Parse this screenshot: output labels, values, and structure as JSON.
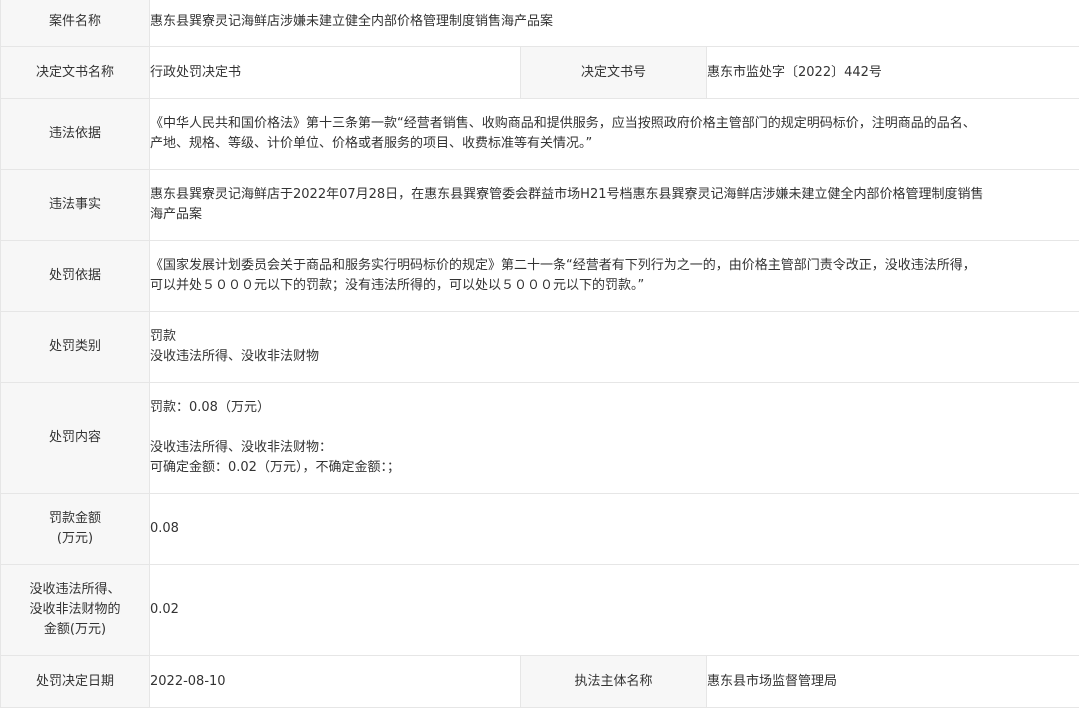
{
  "rows": {
    "case_name": {
      "label": "案件名称",
      "value": "惠东县巽寮灵记海鲜店涉嫌未建立健全内部价格管理制度销售海产品案"
    },
    "decision_doc": {
      "label": "决定文书名称",
      "value": "行政处罚决定书",
      "label2": "决定文书号",
      "value2": "惠东市监处字〔2022〕442号"
    },
    "violation_basis": {
      "label": "违法依据",
      "lines": [
        "《中华人民共和国价格法》第十三条第一款“经营者销售、收购商品和提供服务，应当按照政府价格主管部门的规定明码标价，注明商品的品名、",
        "产地、规格、等级、计价单位、价格或者服务的项目、收费标准等有关情况。”"
      ]
    },
    "violation_facts": {
      "label": "违法事实",
      "lines": [
        "惠东县巽寮灵记海鲜店于2022年07月28日，在惠东县巽寮管委会群益市场H21号档惠东县巽寮灵记海鲜店涉嫌未建立健全内部价格管理制度销售",
        "海产品案"
      ]
    },
    "penalty_basis": {
      "label": "处罚依据",
      "lines": [
        "《国家发展计划委员会关于商品和服务实行明码标价的规定》第二十一条“经营者有下列行为之一的，由价格主管部门责令改正，没收违法所得，",
        "可以并处５０００元以下的罚款；没有违法所得的，可以处以５０００元以下的罚款。”"
      ]
    },
    "penalty_type": {
      "label": "处罚类别",
      "lines": [
        "罚款",
        "没收违法所得、没收非法财物"
      ]
    },
    "penalty_content": {
      "label": "处罚内容",
      "line1": "罚款：0.08（万元）",
      "line2": "没收违法所得、没收非法财物：",
      "line3": "可确定金额：0.02（万元），不确定金额：；"
    },
    "fine_amount": {
      "label_line1": "罚款金额",
      "label_line2": "(万元)",
      "value": "0.08"
    },
    "confiscation_amount": {
      "label_line1": "没收违法所得、",
      "label_line2": "没收非法财物的",
      "label_line3": "金额(万元)",
      "value": "0.02"
    },
    "decision_date": {
      "label": "处罚决定日期",
      "value": "2022-08-10",
      "label2": "执法主体名称",
      "value2": "惠东县市场监督管理局"
    }
  }
}
